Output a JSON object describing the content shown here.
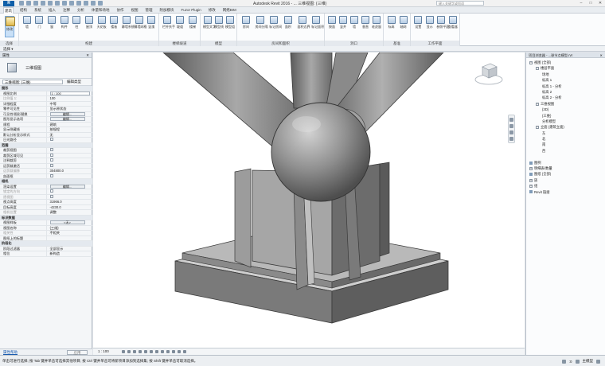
{
  "titlebar": {
    "app_label": "R",
    "title": "Autodesk Revit 2016  -  ...   三维视图: {三维}",
    "search_placeholder": "键入关键字或短语",
    "minimize": "–",
    "maximize": "□",
    "close": "✕"
  },
  "tabs": [
    "建筑",
    "结构",
    "系统",
    "插入",
    "注释",
    "分析",
    "体量和场地",
    "协作",
    "视图",
    "管理",
    "附加模块",
    "Fuzor Plugin",
    "修改",
    "网络BIM"
  ],
  "ribbon": {
    "groups": [
      {
        "label": "选择",
        "tools": [
          "修改"
        ]
      },
      {
        "label": "构建",
        "tools": [
          "墙",
          "门",
          "窗",
          "构件",
          "柱",
          "屋顶",
          "天花板",
          "楼板",
          "幕墙系统",
          "幕墙网格",
          "竖溾"
        ]
      },
      {
        "label": "楼梯坡道",
        "tools": [
          "栏杆扶手",
          "坡道",
          "楼梯"
        ]
      },
      {
        "label": "模型",
        "tools": [
          "模型文字",
          "模型线",
          "模型组"
        ]
      },
      {
        "label": "房间和面积",
        "tools": [
          "房间",
          "房间分隔",
          "标记房间",
          "面积",
          "面积边界",
          "标记面积"
        ]
      },
      {
        "label": "洞口",
        "tools": [
          "按面",
          "竖井",
          "墙",
          "垂直",
          "老虎窗"
        ]
      },
      {
        "label": "基准",
        "tools": [
          "标高",
          "轴网"
        ]
      },
      {
        "label": "工作平面",
        "tools": [
          "设置",
          "显示",
          "参照平面",
          "查看器"
        ]
      }
    ]
  },
  "selection_label": "选择 ▾",
  "properties": {
    "header": "属性",
    "close": "✕",
    "type_name": "三维视图",
    "selector": "三维视图: {三维}",
    "edit_type": "编辑类型",
    "rows": [
      {
        "sec": true,
        "k": "图形"
      },
      {
        "k": "视图比例",
        "v": "1 : 100",
        "kind": "inp"
      },
      {
        "k": "比例值 1:",
        "v": "100",
        "dim": true
      },
      {
        "k": "详细程度",
        "v": "中等"
      },
      {
        "k": "零件可见性",
        "v": "显示原状态"
      },
      {
        "k": "可见性/图形替换",
        "v": "编辑...",
        "kind": "btn"
      },
      {
        "k": "图形显示选项",
        "v": "编辑...",
        "kind": "btn"
      },
      {
        "k": "规程",
        "v": "建筑"
      },
      {
        "k": "显示隐藏线",
        "v": "按规程"
      },
      {
        "k": "默认分析显示样式",
        "v": "无"
      },
      {
        "k": "日光路径",
        "v": "",
        "kind": "chk"
      },
      {
        "sec": true,
        "k": "范围"
      },
      {
        "k": "裁剪视图",
        "v": "",
        "kind": "chk"
      },
      {
        "k": "裁剪区域可见",
        "v": "",
        "kind": "chk"
      },
      {
        "k": "注释裁剪",
        "v": "",
        "kind": "chk"
      },
      {
        "k": "远剪裁激活",
        "v": "",
        "kind": "chk"
      },
      {
        "k": "远剪裁偏移",
        "v": "304800.0",
        "dim": true
      },
      {
        "k": "剖面框",
        "v": "",
        "kind": "chk"
      },
      {
        "sec": true,
        "k": "相机"
      },
      {
        "k": "渲染设置",
        "v": "编辑...",
        "kind": "btn"
      },
      {
        "k": "锁定的方向",
        "v": "",
        "kind": "chk",
        "dim": true
      },
      {
        "k": "透视图",
        "v": "",
        "kind": "chk",
        "dim": true
      },
      {
        "k": "视点高度",
        "v": "31966.0"
      },
      {
        "k": "目标高度",
        "v": "-4230.0"
      },
      {
        "k": "相机位置",
        "v": "调整",
        "dim": true
      },
      {
        "sec": true,
        "k": "标识数据"
      },
      {
        "k": "视图样板",
        "v": "<无>",
        "kind": "btn"
      },
      {
        "k": "视图名称",
        "v": "{三维}"
      },
      {
        "k": "相关性",
        "v": "不相关",
        "dim": true
      },
      {
        "k": "图纸上的标题",
        "v": ""
      },
      {
        "sec": true,
        "k": "阶段化"
      },
      {
        "k": "阶段过滤器",
        "v": "全部显示"
      },
      {
        "k": "相位",
        "v": "新构造"
      }
    ],
    "help_link": "属性帮助",
    "apply": "应用"
  },
  "viewport": {
    "scale": "1 : 100"
  },
  "browser": {
    "header": "项目浏览器 - ...球节点模型.rvt",
    "close": "✕",
    "nodes": [
      {
        "d": 0,
        "t": "−",
        "label": "视图 (全部)"
      },
      {
        "d": 1,
        "t": "−",
        "label": "楼层平面"
      },
      {
        "d": 2,
        "label": "场地"
      },
      {
        "d": 2,
        "label": "标高 1"
      },
      {
        "d": 2,
        "label": "标高 1 - 分析"
      },
      {
        "d": 2,
        "label": "标高 2"
      },
      {
        "d": 2,
        "label": "标高 2 - 分析"
      },
      {
        "d": 1,
        "t": "−",
        "label": "三维视图"
      },
      {
        "d": 2,
        "label": "{3D}"
      },
      {
        "d": 2,
        "label": "{三维}"
      },
      {
        "d": 2,
        "label": "分析模型"
      },
      {
        "d": 1,
        "t": "−",
        "label": "立面 (建筑立面)"
      },
      {
        "d": 2,
        "label": "东"
      },
      {
        "d": 2,
        "label": "北"
      },
      {
        "d": 2,
        "label": "南"
      },
      {
        "d": 2,
        "label": "西"
      },
      {
        "d": 0,
        "label": ""
      },
      {
        "d": 0,
        "ic": true,
        "label": "图例"
      },
      {
        "d": 0,
        "t": "+",
        "label": "明细表/数量"
      },
      {
        "d": 0,
        "ic": true,
        "label": "图纸 (全部)"
      },
      {
        "d": 0,
        "t": "+",
        "label": "族"
      },
      {
        "d": 0,
        "t": "+",
        "label": "组"
      },
      {
        "d": 0,
        "ic": true,
        "label": "Revit 链接"
      }
    ]
  },
  "status": {
    "message": "单击可进行选择; 按 Tab 键并单击可选择其他项目; 按 Ctrl 键并单击可将新项目添加到选择集; 按 Shift 键并单击可取消选择。",
    "zero": ":0",
    "model": "主模型"
  }
}
